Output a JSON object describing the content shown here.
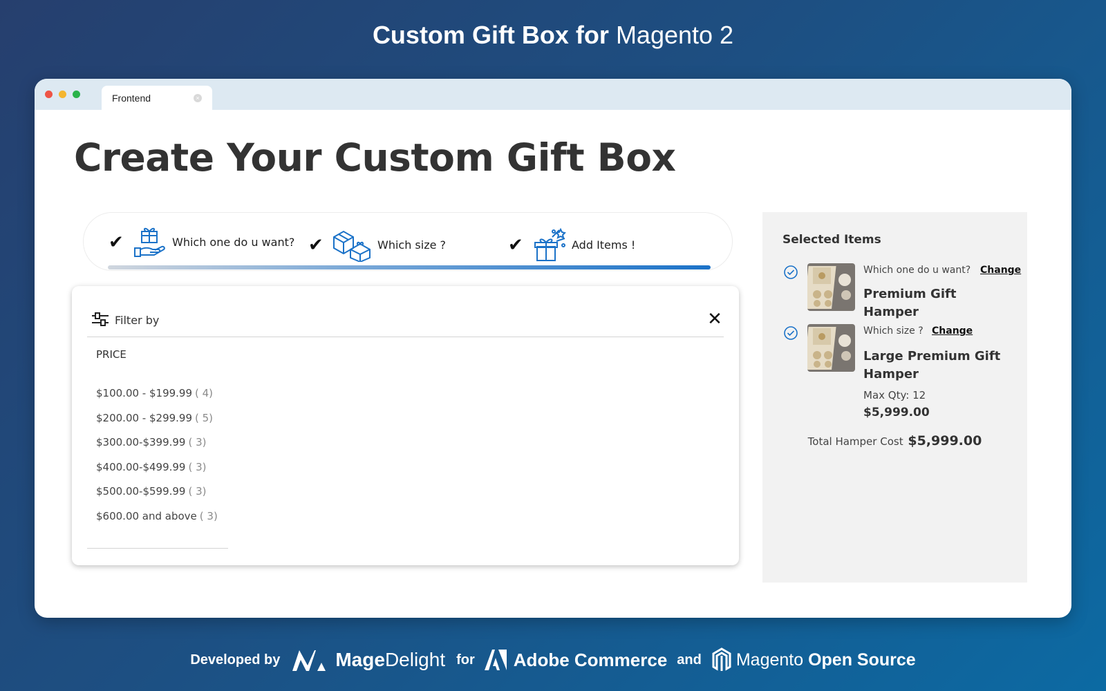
{
  "banner": {
    "title_bold": "Custom Gift Box for",
    "title_light": "Magento 2"
  },
  "browser": {
    "tab_label": "Frontend"
  },
  "page": {
    "title": "Create Your Custom Gift Box"
  },
  "steps": [
    {
      "label": "Which one do u want?",
      "icon": "gift-hand-icon"
    },
    {
      "label": "Which size ?",
      "icon": "gift-boxes-icon"
    },
    {
      "label": "Add Items !",
      "icon": "gift-sparkle-icon"
    }
  ],
  "filter": {
    "label": "Filter by",
    "section": "PRICE",
    "options": [
      {
        "range": "$100.00 - $199.99",
        "count": "( 4)"
      },
      {
        "range": "$200.00 - $299.99",
        "count": "( 5)"
      },
      {
        "range": "$300.00-$399.99",
        "count": "( 3)"
      },
      {
        "range": "$400.00-$499.99",
        "count": "( 3)"
      },
      {
        "range": "$500.00-$599.99",
        "count": "( 3)"
      },
      {
        "range": "$600.00 and above",
        "count": "( 3)"
      }
    ]
  },
  "selected": {
    "title": "Selected Items",
    "items": [
      {
        "question": "Which one do u want?",
        "change": "Change",
        "name": "Premium Gift Hamper"
      },
      {
        "question": "Which size ?",
        "change": "Change",
        "name": "Large Premium Gift Hamper",
        "max_qty": "Max Qty: 12",
        "price": "$5,999.00"
      }
    ],
    "total_label": "Total Hamper Cost",
    "total_value": "$5,999.00"
  },
  "footer": {
    "developed_by": "Developed by",
    "brand_bold": "Mage",
    "brand_light": "Delight",
    "for": "for",
    "adobe": "Adobe Commerce",
    "and": "and",
    "magento_light": "Magento",
    "magento_bold": "Open Source"
  },
  "colors": {
    "accent_blue": "#1b72c8",
    "bg_start": "#263f6e",
    "bg_end": "#0c6aa3"
  }
}
